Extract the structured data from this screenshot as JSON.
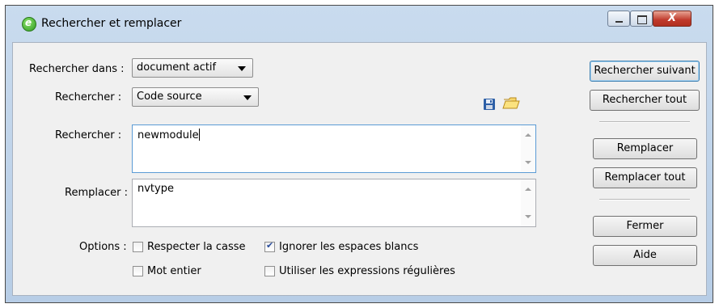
{
  "window": {
    "title": "Rechercher et remplacer",
    "app_icon_glyph": "e",
    "close_glyph": "X"
  },
  "form": {
    "search_in": {
      "label": "Rechercher dans :",
      "value": "document actif"
    },
    "search_type": {
      "label": "Rechercher :",
      "value": "Code source"
    },
    "find": {
      "label": "Rechercher :",
      "value": "newmodule"
    },
    "replace": {
      "label": "Remplacer :",
      "value": "nvtype"
    },
    "options_label": "Options :",
    "options": [
      {
        "label": "Respecter la casse",
        "checked": false
      },
      {
        "label": "Ignorer les espaces blancs",
        "checked": true
      },
      {
        "label": "Mot entier",
        "checked": false
      },
      {
        "label": "Utiliser les expressions régulières",
        "checked": false
      }
    ]
  },
  "buttons": {
    "find_next": "Rechercher suivant",
    "find_all": "Rechercher tout",
    "replace": "Remplacer",
    "replace_all": "Remplacer tout",
    "close": "Fermer",
    "help": "Aide"
  },
  "icons": {
    "save": "floppy-disk-icon",
    "open": "folder-open-icon"
  }
}
